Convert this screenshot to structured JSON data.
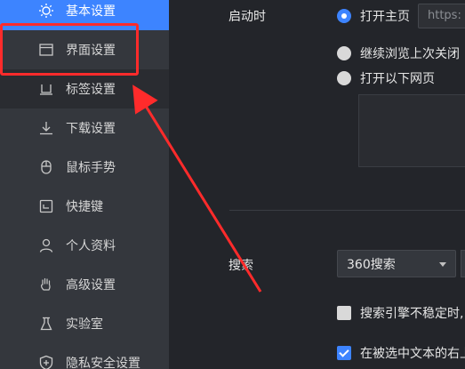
{
  "sidebar": {
    "items": [
      {
        "label": "基本设置",
        "icon": "sun-gear-icon"
      },
      {
        "label": "界面设置",
        "icon": "window-icon"
      },
      {
        "label": "标签设置",
        "icon": "tab-icon"
      },
      {
        "label": "下载设置",
        "icon": "download-icon"
      },
      {
        "label": "鼠标手势",
        "icon": "mouse-icon"
      },
      {
        "label": "快捷键",
        "icon": "keyboard-shortcut-icon"
      },
      {
        "label": "个人资料",
        "icon": "person-icon"
      },
      {
        "label": "高级设置",
        "icon": "hand-icon"
      },
      {
        "label": "实验室",
        "icon": "flask-icon"
      },
      {
        "label": "隐私安全设置",
        "icon": "shield-plus-icon"
      }
    ],
    "active_index": 0
  },
  "startup": {
    "label": "启动时",
    "options": [
      {
        "label": "打开主页",
        "checked": true
      },
      {
        "label": "继续浏览上次关闭",
        "checked": false
      },
      {
        "label": "打开以下网页",
        "checked": false
      }
    ],
    "homepage_value": "https:"
  },
  "search": {
    "label": "搜索",
    "engine": "360搜索",
    "options": [
      {
        "label": "搜索引擎不稳定时,",
        "checked": false
      },
      {
        "label": "在被选中文本的右上",
        "checked": true
      }
    ]
  },
  "colors": {
    "accent": "#3d84ff",
    "annotation_red": "#ff2b2b",
    "sidebar_bg": "#34373d",
    "main_bg": "#23252a"
  }
}
